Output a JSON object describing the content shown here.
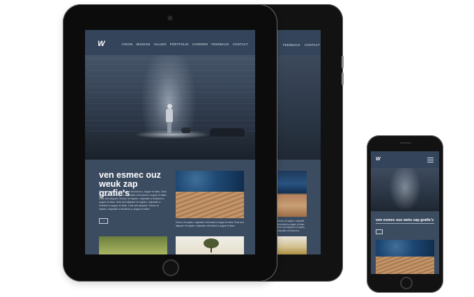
{
  "brand": {
    "logo_text": "W"
  },
  "nav": {
    "items": [
      "VISION",
      "MISSION",
      "VALUES",
      "PORTFOLIO",
      "CAREERS",
      "FEEDBACK",
      "CONTACT"
    ]
  },
  "content": {
    "headline": "ven esmec ouz weuk zap grafie's",
    "paragraph": "Donec in sapien, vulputate a tincidunt a, augue et diam. Duis sed aliquam mi sapien, vulputate a tincidunt a augue et diam. Duis sed aliquam. Donec mi sapien, vulputate a tincidunt a augue et diam. Duis sed aliquam mi sapien, vulputate a tincidunt a augue et diam. Duis sed aliquam. Donec in sapien, vulputate a tincidunt a, augue et diam.",
    "button_label": "—",
    "photo_caption": "Donec mi sapien, vulputate a tincidunt a augue et diam. Duis sed aliquam mi sapien, vulputate a tincidunt a augue et diam."
  },
  "back_tablet": {
    "nav_items": [
      "VISION",
      "FEEDBACK",
      "CONTACT"
    ],
    "caption": "Donec mi sapien, vulputate a tincidunt a augue et diam. Duis sed aliquam mi sapien, vulputate a tincidunt a."
  },
  "phone": {
    "headline": "ven esmec ouz wetu zap grafie's",
    "menu_icon": "hamburger-menu-icon"
  },
  "colors": {
    "screen_bg": "#3b4b60",
    "nav_bg": "#34445a",
    "device_body": "#0c0c0c",
    "page_bg": "#ffffff"
  }
}
